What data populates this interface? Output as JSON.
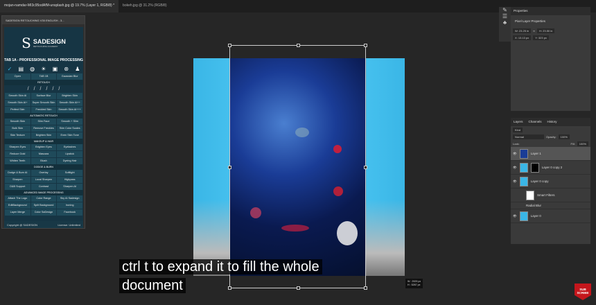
{
  "tabs": [
    "mojan-namdar-MI3c95odAfM-unsplash.jpg @ 19.7% (Layer 1, RGB/8) *",
    "bokeh.jpg @ 31.2% (RGB/8)"
  ],
  "plugin": {
    "title": "SADESIGN RETOUCHING V35 ENGLISH - 3...",
    "logo": "SADESIGN",
    "logo_sub": "RETOUCHING ACADEMY",
    "tab_title": "TAB 1A - PROFESSIONAL IMAGE PROCESSING",
    "top_buttons": [
      "Open",
      "TAB 1B",
      "Gaussian Blur"
    ],
    "sections": [
      {
        "title": "RETOUCH",
        "tools": true,
        "buttons": [
          "Smooth Skin AI",
          "Surface Blur",
          "Brighten Skin",
          "Smooth Skin AI+",
          "Super Smooth Skin",
          "Smooth Skin AI++",
          "Perfect Skin",
          "Freckled Skin",
          "Smooth Skin AI+++"
        ]
      },
      {
        "title": "AUTOMATIC RETOUCH",
        "buttons": [
          "Smooth Skin",
          "Slim Face",
          "Smooth + Slim",
          "Bulk Skin",
          "Remove Freckles",
          "Skin Color Scales",
          "Skin Texture",
          "Brighten Skin",
          "Even Skin Tone"
        ]
      },
      {
        "title": "MAKEUP & HAIR",
        "buttons": [
          "Sharpen Eyes",
          "Brighten Eyes",
          "Eyelashes",
          "Reduce Gold",
          "Mascara",
          "Lipstick",
          "Whiten Teeth",
          "Blush",
          "Dyeing Hair"
        ]
      },
      {
        "title": "DODGE & BURN",
        "buttons": [
          "Dodge & Burn AI",
          "Overlay",
          "Softlight",
          "Sharpen",
          "Local Sharpen",
          "Highpass",
          "D&B Support",
          "Contrast",
          "Sharpen AI"
        ]
      },
      {
        "title": "ADVANCED IMAGE PROCESSING",
        "buttons": [
          "Attach The Logo",
          "Color Range",
          "Sky AI Sadesign",
          "EditBackground",
          "Split Background",
          "Ironing",
          "Layer Merge",
          "Color SaDesign",
          "Facebook"
        ]
      }
    ],
    "copyright": "Copyright @ SADESIGN",
    "license": "License: Unlimited"
  },
  "dims": {
    "w": "W : 2929 px",
    "h": "H : 5267 px"
  },
  "subtitle": {
    "line1": "ctrl t to expand it to fill the whole",
    "line2": "document"
  },
  "properties": {
    "tab": "Properties",
    "type": "Pixel Layer Properties",
    "w": "W: 23.25 in",
    "h": "H: 23.50 in",
    "x": "X: 13.13 px",
    "y": "Y: 323 px"
  },
  "layers": {
    "tabs": [
      "Layers",
      "Channels",
      "History"
    ],
    "kind": "Kind",
    "blend": "Normal",
    "opacity_label": "Opacity:",
    "opacity": "100%",
    "lock": "Lock:",
    "fill_label": "Fill:",
    "fill": "100%",
    "items": [
      "Layer 1",
      "Layer 0 copy 2",
      "Layer 0 copy",
      "Smart Filters",
      "Radial Blur",
      "Layer 0"
    ]
  },
  "badge": "SUB SCRIBE"
}
